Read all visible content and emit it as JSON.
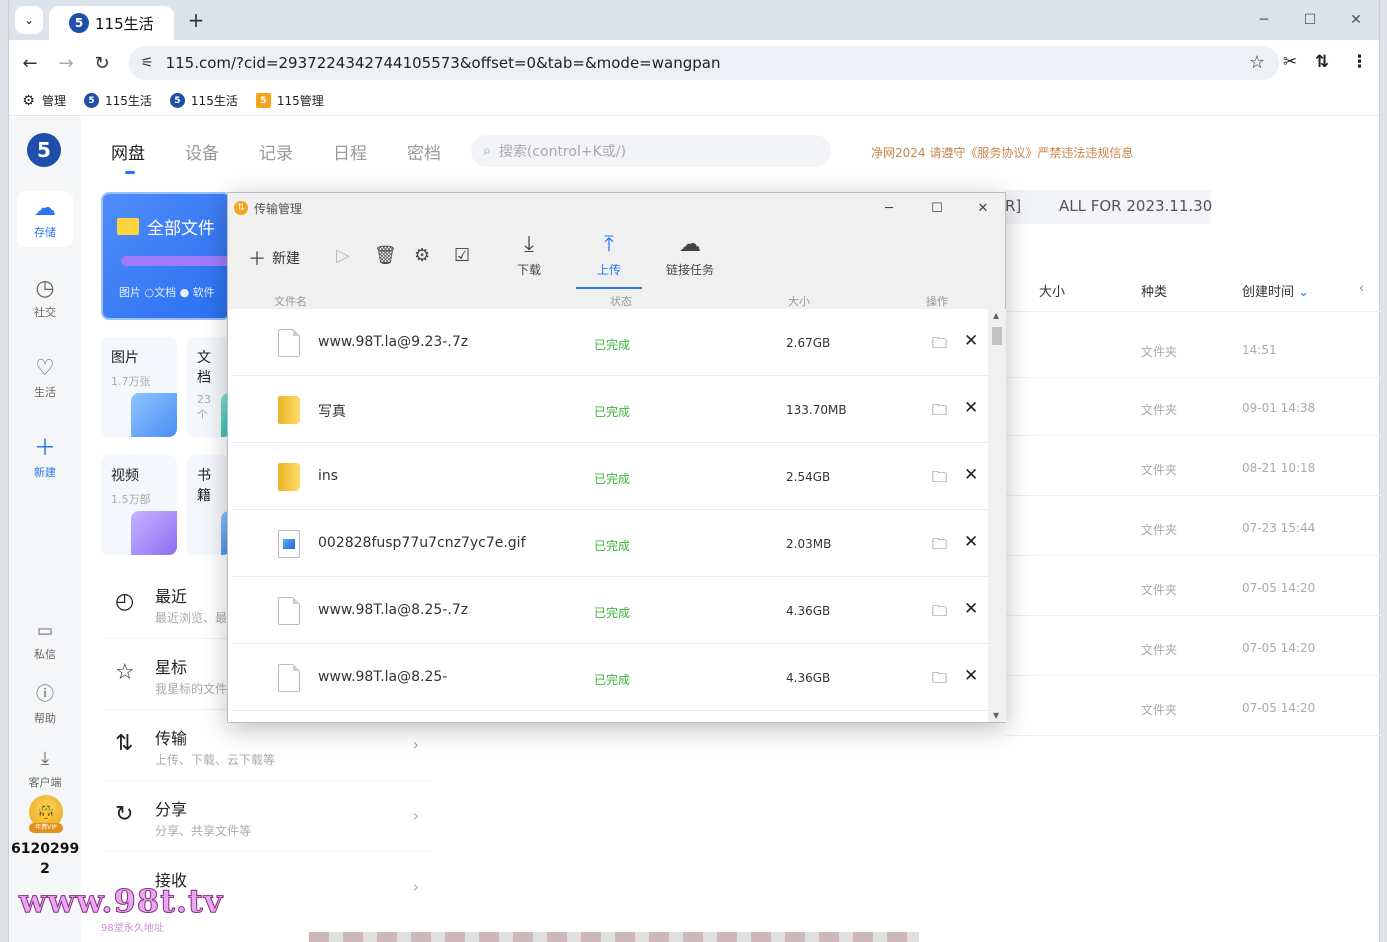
{
  "browser": {
    "tab_title": "115生活",
    "tab_favicon": "5",
    "url": "115.com/?cid=2937224342744105573&offset=0&tab=&mode=wangpan",
    "bookmarks": [
      {
        "label": "管理",
        "icon": "gear-icon"
      },
      {
        "label": "115生活",
        "icon": "5"
      },
      {
        "label": "115生活",
        "icon": "5"
      },
      {
        "label": "115管理",
        "icon": "5"
      }
    ]
  },
  "rail": {
    "logo": "5",
    "items": [
      {
        "label": "存储",
        "icon": "cloud-icon"
      },
      {
        "label": "社交",
        "icon": "clock-icon"
      },
      {
        "label": "生活",
        "icon": "heart-icon"
      },
      {
        "label": "新建",
        "icon": "plus-icon"
      },
      {
        "label": "私信",
        "icon": "chat-icon"
      },
      {
        "label": "帮助",
        "icon": "help-icon"
      },
      {
        "label": "客户端",
        "icon": "download-icon"
      }
    ],
    "avatar_badge": "年费VIP",
    "user_number": "6120299 2"
  },
  "topnav": {
    "items": [
      "网盘",
      "设备",
      "记录",
      "日程",
      "密档"
    ],
    "search_placeholder": "搜索(control+K或/)",
    "notice": "净网2024 请遵守《服务协议》严禁违法违规信息"
  },
  "filepanel": {
    "allfiles_title": "全部文件",
    "allfiles_legend": "图片 ○文档 ● 软件",
    "cards": [
      {
        "title": "图片",
        "sub": "1.7万张"
      },
      {
        "title": "文档",
        "sub": "23个"
      },
      {
        "title": "视频",
        "sub": "1.5万部"
      },
      {
        "title": "书籍",
        "sub": ""
      }
    ],
    "menu": [
      {
        "title": "最近",
        "sub": "最近浏览、最",
        "icon": "history-icon"
      },
      {
        "title": "星标",
        "sub": "我星标的文件",
        "icon": "star-outline-icon"
      },
      {
        "title": "传输",
        "sub": "上传、下载、云下载等",
        "icon": "transfer-icon"
      },
      {
        "title": "分享",
        "sub": "分享、共享文件等",
        "icon": "share-icon"
      },
      {
        "title": "接收",
        "sub": "",
        "icon": "receive-icon"
      }
    ]
  },
  "table": {
    "banner_bracket": "R]",
    "banner": "ALL FOR 2023.11.30",
    "headers": {
      "size": "大小",
      "kind": "种类",
      "created": "创建时间"
    },
    "rows": [
      {
        "kind": "文件夹",
        "time": "14:51"
      },
      {
        "kind": "文件夹",
        "time": "09-01 14:38"
      },
      {
        "kind": "文件夹",
        "time": "08-21 10:18"
      },
      {
        "kind": "文件夹",
        "time": "07-23 15:44"
      },
      {
        "kind": "文件夹",
        "time": "07-05 14:20"
      },
      {
        "kind": "文件夹",
        "time": "07-05 14:20"
      },
      {
        "kind": "文件夹",
        "time": "07-05 14:20"
      }
    ]
  },
  "dialog": {
    "title": "传输管理",
    "toolbar": {
      "new_label": "新建",
      "tabs": [
        {
          "label": "下载",
          "icon": "download-arrow-icon"
        },
        {
          "label": "上传",
          "icon": "upload-arrow-icon"
        },
        {
          "label": "链接任务",
          "icon": "cloud-download-icon"
        }
      ],
      "active_tab": "上传"
    },
    "columns": {
      "name": "文件名",
      "status": "状态",
      "size": "大小",
      "action": "操作"
    },
    "rows": [
      {
        "name": "www.98T.la@9.23-.7z",
        "status": "已完成",
        "size": "2.67GB",
        "type": "file"
      },
      {
        "name": "写真",
        "status": "已完成",
        "size": "133.70MB",
        "type": "folder"
      },
      {
        "name": "ins",
        "status": "已完成",
        "size": "2.54GB",
        "type": "folder"
      },
      {
        "name": "002828fusp77u7cnz7yc7e.gif",
        "status": "已完成",
        "size": "2.03MB",
        "type": "image"
      },
      {
        "name": "www.98T.la@8.25-.7z",
        "status": "已完成",
        "size": "4.36GB",
        "type": "file"
      },
      {
        "name": "www.98T.la@8.25-",
        "status": "已完成",
        "size": "4.36GB",
        "type": "file"
      }
    ]
  },
  "watermark": {
    "text": "www.98t.tv",
    "sub": "98堂永久地址"
  },
  "colors": {
    "accent": "#2b76f5",
    "done_green": "#3cb43c",
    "notice_orange": "#c9844a"
  }
}
